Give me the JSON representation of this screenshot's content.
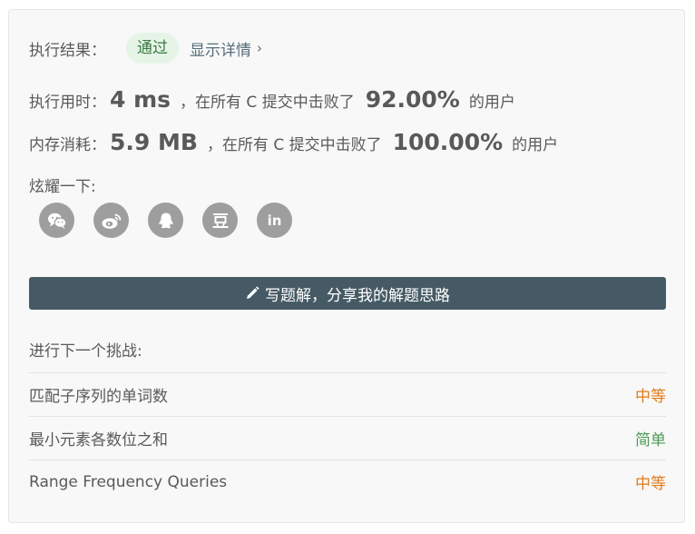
{
  "result": {
    "label": "执行结果：",
    "status": "通过",
    "details_link": "显示详情",
    "chevron": "›"
  },
  "runtime": {
    "label": "执行用时：",
    "value": "4 ms",
    "beat_text": "，在所有 C 提交中击败了",
    "percent": "92.00%",
    "suffix": "的用户"
  },
  "memory": {
    "label": "内存消耗：",
    "value": "5.9 MB",
    "beat_text": "，在所有 C 提交中击败了",
    "percent": "100.00%",
    "suffix": "的用户"
  },
  "share": {
    "label": "炫耀一下:",
    "icons": [
      "wechat-icon",
      "weibo-icon",
      "qq-icon",
      "douban-icon",
      "linkedin-icon"
    ],
    "linkedin_text": "in"
  },
  "write_button": {
    "label": "写题解，分享我的解题思路",
    "icon": "pencil-icon"
  },
  "next": {
    "label": "进行下一个挑战:",
    "problems": [
      {
        "title": "匹配子序列的单词数",
        "difficulty": "中等"
      },
      {
        "title": "最小元素各数位之和",
        "difficulty": "简单"
      },
      {
        "title": "Range Frequency Queries",
        "difficulty": "中等"
      }
    ]
  },
  "colors": {
    "badge_bg": "#e6f4e8",
    "badge_text": "#3b7a3f",
    "button_bg": "#455a64",
    "medium": "#e07b1a",
    "easy": "#4d9a57"
  }
}
